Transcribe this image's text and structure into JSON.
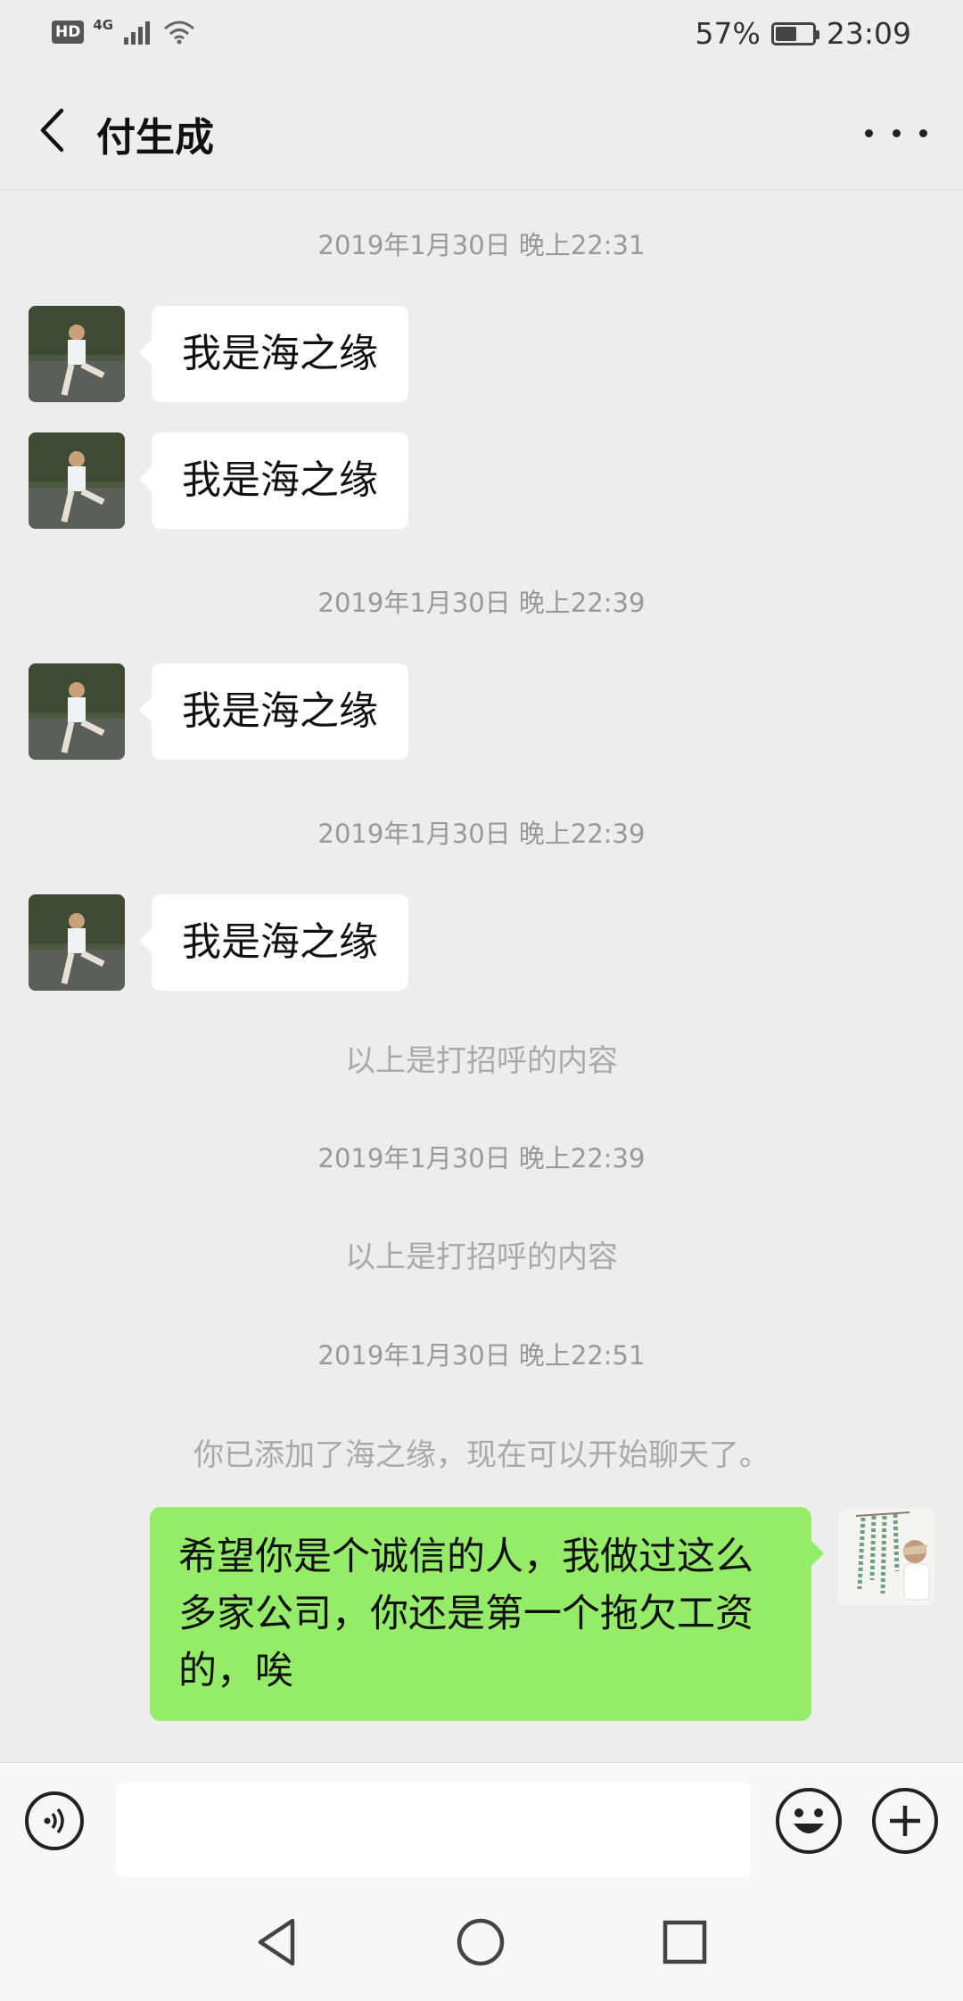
{
  "status_bar": {
    "hd": "HD",
    "network": "4G",
    "battery_percent": "57%",
    "battery_level": 0.57,
    "time": "23:09"
  },
  "header": {
    "contact_name": "付生成",
    "back_icon": "chevron-left-icon",
    "more_icon": "more-dots-icon"
  },
  "chat": {
    "time_labels": [
      "2019年1月30日 晚上22:31",
      "2019年1月30日 晚上22:39",
      "2019年1月30日 晚上22:39",
      "2019年1月30日 晚上22:39",
      "2019年1月30日 晚上22:51"
    ],
    "incoming_messages": [
      "我是海之缘",
      "我是海之缘",
      "我是海之缘",
      "我是海之缘"
    ],
    "system_notices": [
      "以上是打招呼的内容",
      "以上是打招呼的内容",
      "你已添加了海之缘，现在可以开始聊天了。"
    ],
    "outgoing_message": "希望你是个诚信的人，我做过这么多家公司，你还是第一个拖欠工资的，唉"
  },
  "input_bar": {
    "voice_icon": "voice-icon",
    "text_value": "",
    "emoji_icon": "emoji-icon",
    "plus_icon": "plus-icon"
  },
  "nav_bar": {
    "back_icon": "triangle-back-icon",
    "home_icon": "circle-home-icon",
    "recent_icon": "square-recent-icon"
  },
  "colors": {
    "background": "#ededed",
    "incoming_bubble": "#ffffff",
    "outgoing_bubble": "#95ec69"
  }
}
